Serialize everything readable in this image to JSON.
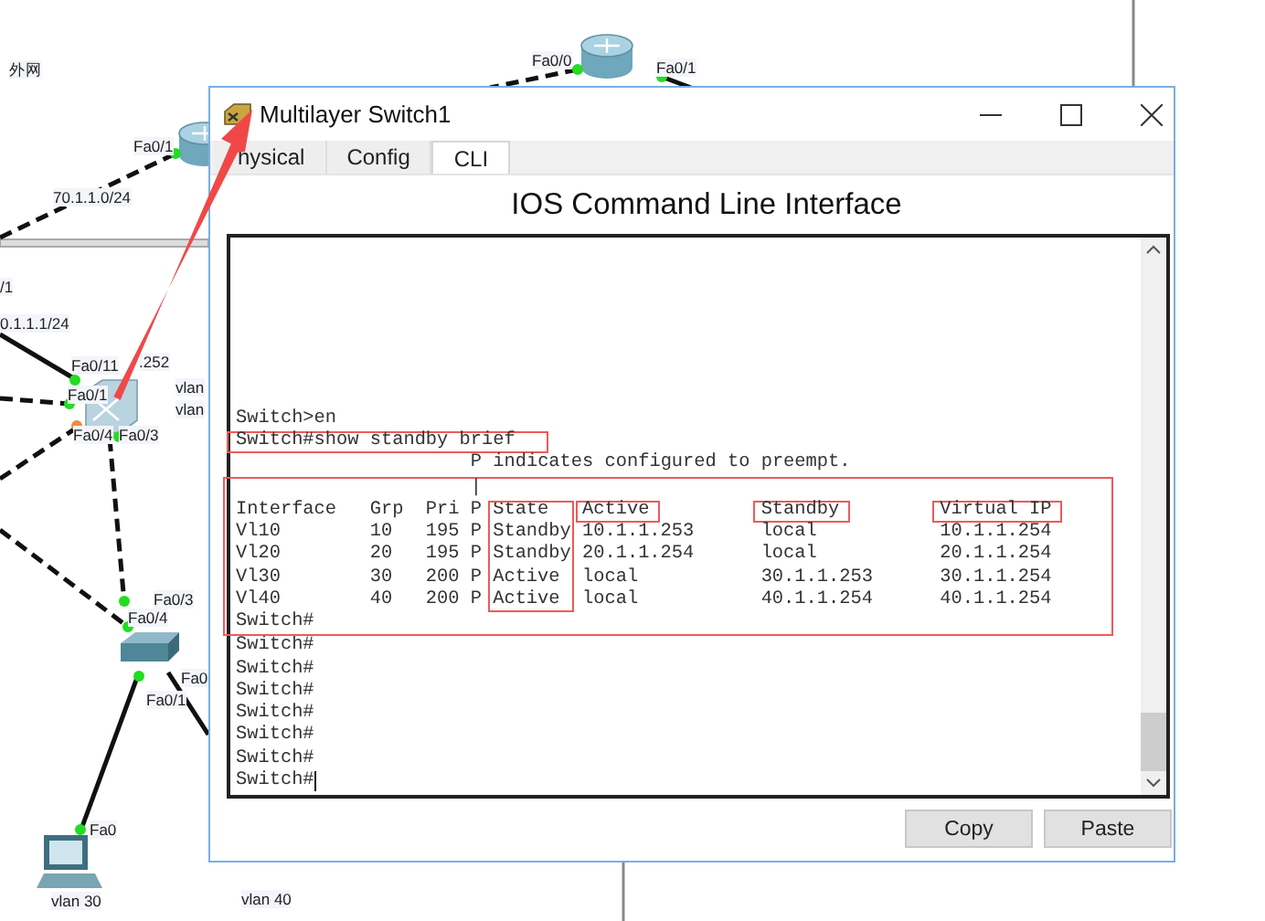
{
  "topology": {
    "labels": [
      "外网",
      "Fa0/0",
      "Fa0/1",
      "Fa0/1",
      "70.1.1.0/24",
      "/1",
      "0.1.1.1/24",
      ".252",
      "Fa0/11",
      "Fa0/1",
      "vlan",
      "vlan",
      "Fa0/4",
      "Fa0/3",
      "Fa0/3",
      "Fa0/4",
      "Fa0",
      "Fa0/1",
      "Fa0",
      "vlan 30",
      "vlan 40"
    ]
  },
  "window": {
    "title": "Multilayer Switch1",
    "tabs": [
      {
        "label": "hysical",
        "selected": false
      },
      {
        "label": "Config",
        "selected": false
      },
      {
        "label": "CLI",
        "selected": true
      }
    ],
    "heading": "IOS Command Line Interface",
    "terminal": {
      "lines_before": [
        {
          "text": "Switch>en",
          "highlighted": false
        },
        {
          "text": "Switch#show standby brief",
          "highlighted": true
        },
        {
          "text": "                     P indicates configured to preempt.",
          "highlighted": false
        }
      ],
      "table_highlighted": true,
      "marker_line": "                     |",
      "table": {
        "columns": [
          {
            "label": "Interface",
            "column_boxed": false,
            "header_boxed": false
          },
          {
            "label": "Grp",
            "column_boxed": false,
            "header_boxed": false
          },
          {
            "label": "Pri",
            "column_boxed": false,
            "header_boxed": false
          },
          {
            "label": "P",
            "column_boxed": false,
            "header_boxed": false
          },
          {
            "label": "State",
            "column_boxed": true,
            "header_boxed": false
          },
          {
            "label": "Active",
            "column_boxed": false,
            "header_boxed": true
          },
          {
            "label": "Standby",
            "column_boxed": false,
            "header_boxed": true
          },
          {
            "label": "Virtual IP",
            "column_boxed": false,
            "header_boxed": true
          }
        ],
        "rows": [
          [
            "Vl10",
            "10",
            "195",
            "P",
            "Standby",
            "10.1.1.253",
            "local",
            "10.1.1.254"
          ],
          [
            "Vl20",
            "20",
            "195",
            "P",
            "Standby",
            "20.1.1.254",
            "local",
            "20.1.1.254"
          ],
          [
            "Vl30",
            "30",
            "200",
            "P",
            "Active",
            "local",
            "30.1.1.253",
            "30.1.1.254"
          ],
          [
            "Vl40",
            "40",
            "200",
            "P",
            "Active",
            "local",
            "40.1.1.254",
            "40.1.1.254"
          ]
        ]
      },
      "lines_after": [
        "Switch#",
        "Switch#",
        "Switch#",
        "Switch#",
        "Switch#",
        "Switch#",
        "Switch#",
        "Switch#"
      ]
    },
    "buttons": [
      "Copy",
      "Paste"
    ]
  }
}
